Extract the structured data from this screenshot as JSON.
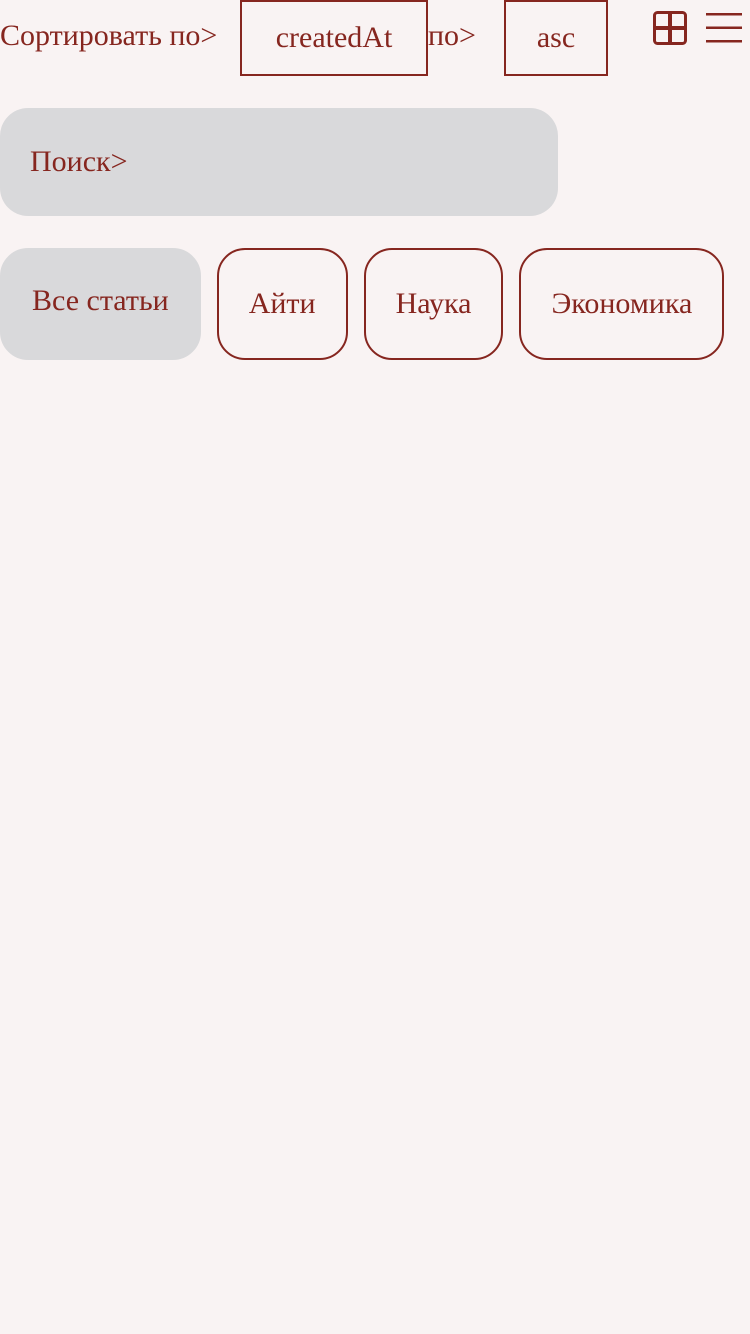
{
  "sort": {
    "label": "Сортировать по>",
    "field_value": "createdAt",
    "order_label": "по>",
    "order_value": "asc"
  },
  "view_toggle": {
    "icons": [
      "grid-view-icon",
      "list-view-icon"
    ]
  },
  "search": {
    "label": "Поиск>",
    "value": ""
  },
  "tabs": [
    {
      "label": "Все статьи",
      "active": true
    },
    {
      "label": "Айти",
      "active": false
    },
    {
      "label": "Наука",
      "active": false
    },
    {
      "label": "Экономика",
      "active": false
    }
  ],
  "colors": {
    "accent": "#86261f",
    "background": "#f9f3f3",
    "chip_bg": "#d9d9db"
  }
}
